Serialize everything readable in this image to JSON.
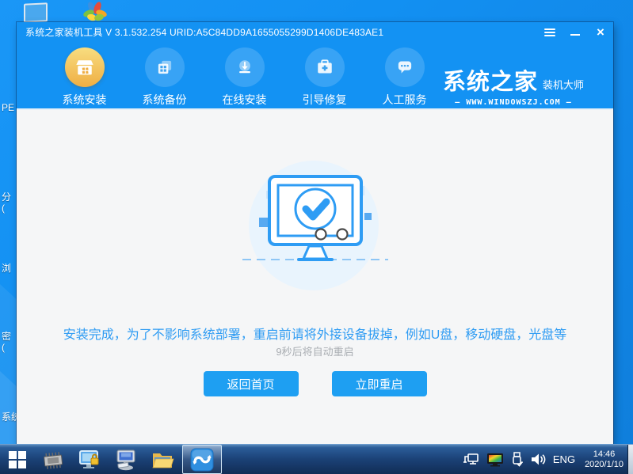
{
  "desktop": {
    "partial_icon_labels": [
      {
        "text": "PE"
      },
      {
        "text": "分\n("
      },
      {
        "text": "浏"
      },
      {
        "text": "密\n("
      },
      {
        "text": "系统"
      }
    ]
  },
  "window": {
    "title": "系统之家装机工具 V 3.1.532.254 URID:A5C84DD9A1655055299D1406DE483AE1",
    "controls": {
      "close_glyph": "×"
    },
    "nav": [
      {
        "label": "系统安装",
        "icon": "install-box-icon",
        "active": true
      },
      {
        "label": "系统备份",
        "icon": "backup-copy-icon",
        "active": false
      },
      {
        "label": "在线安装",
        "icon": "download-icon",
        "active": false
      },
      {
        "label": "引导修复",
        "icon": "repair-kit-icon",
        "active": false
      },
      {
        "label": "人工服务",
        "icon": "chat-support-icon",
        "active": false
      }
    ],
    "logo": {
      "brand": "系统之家",
      "sub": "装机大师",
      "site_line": "—  WWW.WINDOWSZJ.COM  —"
    },
    "main": {
      "message": "安装完成，为了不影响系统部署，重启前请将外接设备拔掉，例如U盘，移动硬盘，光盘等",
      "countdown": "9秒后将自动重启",
      "buttons": [
        {
          "label": "返回首页"
        },
        {
          "label": "立即重启"
        }
      ]
    }
  },
  "taskbar": {
    "lang": "ENG",
    "time": "14:46",
    "date": "2020/1/10"
  },
  "icons": {
    "success_illustration": "monitor-with-checkmark",
    "colors": {
      "accent_blue": "#1392f3",
      "button_blue": "#1e9ff2",
      "active_nav_gradient": [
        "#f8dd80",
        "#efae43"
      ],
      "content_bg": "#f5f6f7",
      "taskbar_dark_blue": "#1b4176"
    }
  }
}
